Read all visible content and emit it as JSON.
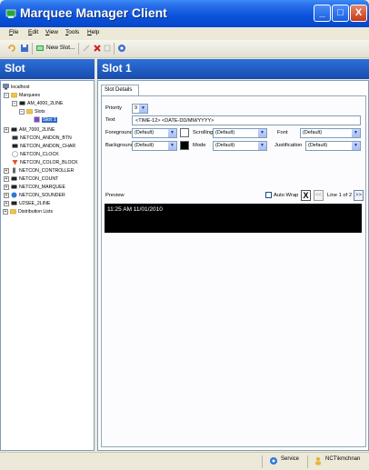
{
  "window": {
    "title": "Marquee Manager Client",
    "controls": {
      "minimize": "_",
      "maximize": "□",
      "close": "X"
    }
  },
  "menu": {
    "items": [
      {
        "key": "F",
        "rest": "ile"
      },
      {
        "key": "E",
        "rest": "dit"
      },
      {
        "key": "V",
        "rest": "iew"
      },
      {
        "key": "T",
        "rest": "ools"
      },
      {
        "key": "H",
        "rest": "elp"
      }
    ]
  },
  "toolbar": {
    "new_slot_label": "New Slot..."
  },
  "left_panel": {
    "header": "Slot",
    "tree": {
      "root": "localhost",
      "marquees": "Marquees",
      "am4000": "AM_4000_2LINE",
      "slots": "Slots",
      "slot1": "Slot 1",
      "am7000": "AM_7000_2LINE",
      "andon_btn": "NETCON_ANDON_BTN",
      "andon_char": "NETCON_ANDON_CHAR",
      "clock": "NETCON_CLOCK",
      "color_block": "NETCON_COLOR_BLOCK",
      "controller": "NETCON_CONTROLLER",
      "count": "NETCON_COUNT",
      "marquee": "NETCON_MARQUEE",
      "sounder": "NETCON_SOUNDER",
      "u2se": "U2SEE_2LINE",
      "distribution": "Distribution Lists"
    }
  },
  "right_panel": {
    "header": "Slot 1",
    "tab": "Slot Details",
    "priority_label": "Priority",
    "priority_value": "9",
    "text_label": "Text",
    "text_value": "<TIME-12>  <DATE-DD/MM/YYYY>",
    "foreground_label": "Foreground",
    "foreground_value": "(Default)",
    "scrolling_label": "Scrolling",
    "scrolling_value": "(Default)",
    "font_label": "Font",
    "font_value": "(Default)",
    "background_label": "Background",
    "background_value": "(Default)",
    "mode_label": "Mode",
    "mode_value": "(Default)",
    "justification_label": "Justification",
    "justification_value": "(Default)",
    "preview_label": "Preview",
    "auto_wrap_label": "Auto Wrap",
    "clear_label": "X",
    "prev_label": "<<",
    "next_label": ">>",
    "line_indicator": "Line 1 of 2",
    "preview_text": "11:25 AM   11/01/2010"
  },
  "status": {
    "service_label": "Service",
    "user_label": "NCT\\kmchnan"
  }
}
